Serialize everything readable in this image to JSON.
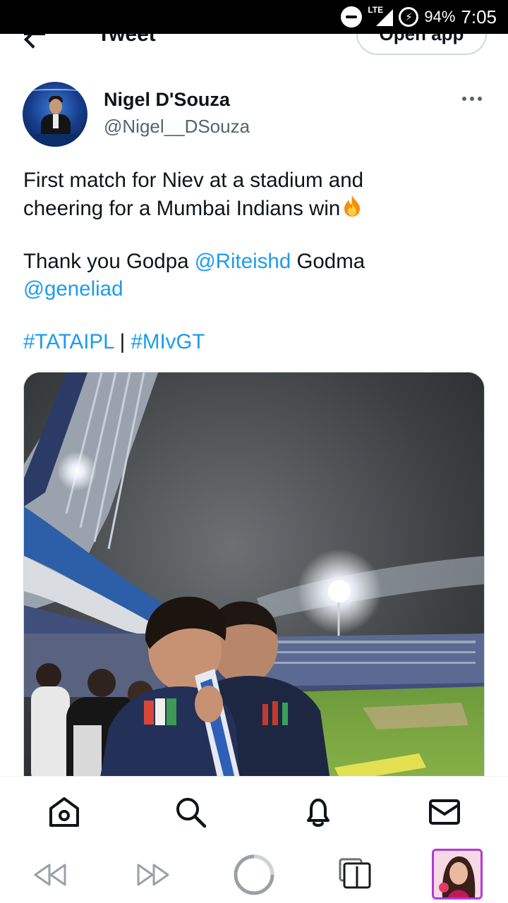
{
  "status_bar": {
    "network_label": "LTE",
    "battery_percent": "94%",
    "time": "7:05"
  },
  "header": {
    "title": "Tweet",
    "open_app_label": "Open app"
  },
  "tweet": {
    "author_name": "Nigel D'Souza",
    "author_handle": "@Nigel__DSouza",
    "line1": "First match for Niev at a stadium and",
    "line2": "cheering for a Mumbai Indians win",
    "thanks_prefix": "Thank you Godpa ",
    "mention1": "@Riteishd",
    "thanks_middle": " Godma",
    "mention2": "@geneliad",
    "hashtag1": "#TATAIPL",
    "hashtag_separator": " | ",
    "hashtag2": "#MIvGT"
  },
  "bottom_nav": {
    "items": [
      {
        "name": "home",
        "icon": "home-icon"
      },
      {
        "name": "search",
        "icon": "search-icon"
      },
      {
        "name": "notifications",
        "icon": "bell-icon"
      },
      {
        "name": "messages",
        "icon": "mail-icon"
      }
    ]
  },
  "system_nav": {
    "items": [
      "rewind-icon",
      "fast-forward-icon",
      "home-circle-icon",
      "tabs-icon",
      "profile-thumbnail"
    ]
  },
  "colors": {
    "link": "#1d9bf0",
    "text": "#0f1419",
    "secondary": "#536471",
    "profile_border": "#b23bd6"
  }
}
